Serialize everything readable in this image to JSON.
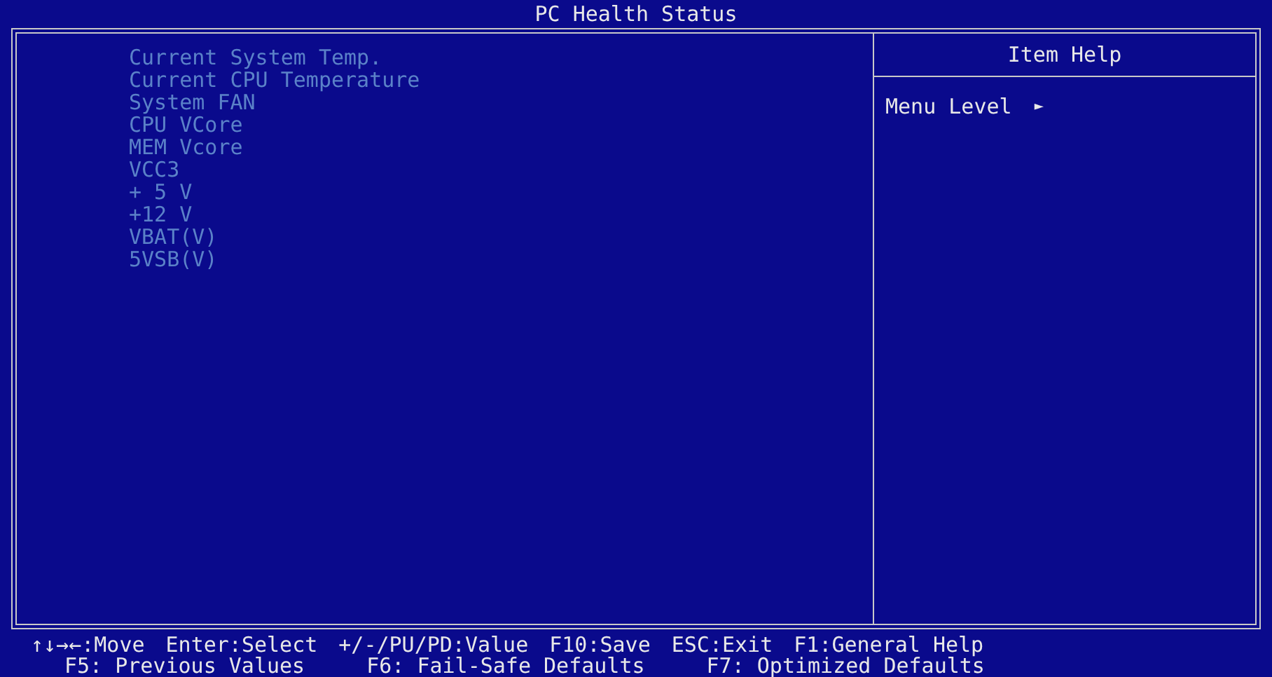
{
  "window": {
    "title": "PC Health Status"
  },
  "items": [
    {
      "label": "Current System Temp.",
      "disabled": true
    },
    {
      "label": "Current CPU Temperature",
      "disabled": true
    },
    {
      "label": "System FAN",
      "disabled": true
    },
    {
      "label": "CPU VCore",
      "disabled": true
    },
    {
      "label": "MEM Vcore",
      "disabled": true
    },
    {
      "label": "VCC3",
      "disabled": true
    },
    {
      "label": "+ 5 V",
      "disabled": true
    },
    {
      "label": "+12 V",
      "disabled": true
    },
    {
      "label": "VBAT(V)",
      "disabled": true
    },
    {
      "label": "5VSB(V)",
      "disabled": true
    }
  ],
  "help_panel": {
    "title": "Item Help",
    "menu_level_label": "Menu Level",
    "menu_level_marker": "►"
  },
  "footer": [
    [
      "↑↓→←:Move",
      "Enter:Select",
      "+/-/PU/PD:Value",
      "F10:Save",
      "ESC:Exit",
      "F1:General Help"
    ],
    [
      "F5: Previous Values",
      "F6: Fail-Safe Defaults",
      "F7: Optimized Defaults"
    ]
  ]
}
